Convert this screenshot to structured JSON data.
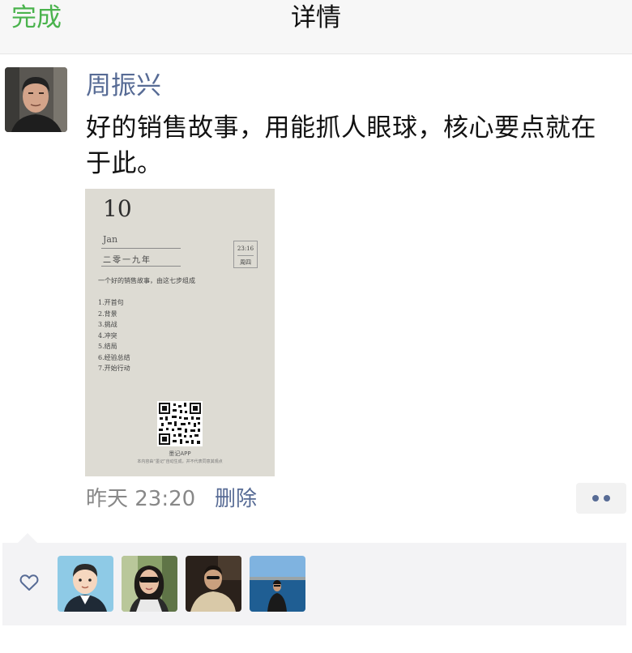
{
  "topbar": {
    "done_label": "完成",
    "title": "详情"
  },
  "post": {
    "author": "周振兴",
    "text": "好的销售故事，用能抓人眼球，核心要点就在于此。",
    "time": "昨天 23:20",
    "delete_label": "删除"
  },
  "image": {
    "day": "10",
    "month": "Jan",
    "year": "二零一九年",
    "time": "23:16",
    "weekday": "周四",
    "subtitle": "一个好的销售故事，由这七步组成",
    "steps": [
      "1.开首句",
      "2.背景",
      "3.挑战",
      "4.冲突",
      "5.结局",
      "6.经验总结",
      "7.开始行动"
    ],
    "app_name": "墨记APP",
    "footer": "本内容由“墨记”自动生成，并不代表同意其观点"
  },
  "likes": {
    "icon": "heart-icon",
    "avatars": [
      "cartoon-avatar",
      "woman-sunglasses-avatar",
      "man-dark-avatar",
      "man-lake-avatar"
    ]
  },
  "colors": {
    "accent_green": "#4ab34d",
    "link_blue": "#576b95",
    "panel_bg": "#f3f3f5",
    "card_bg": "#dddbd3"
  }
}
